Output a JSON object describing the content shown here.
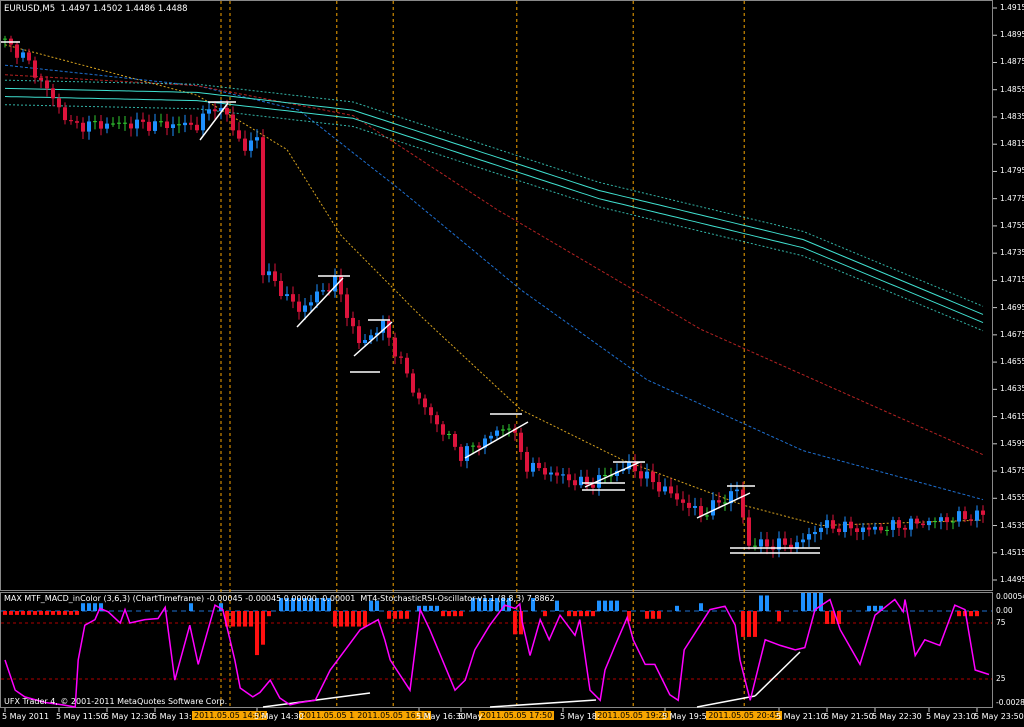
{
  "window": {
    "title": "EURUSD,M5  1.4497 1.4502 1.4486 1.4488"
  },
  "indicator": {
    "title": "MAX MTF_MACD_inColor (3,6,3) (ChartTimeframe) -0.00045 -0.00045 0.00000 -0.00001  MT4-StochasticRSI-Oscillator-v1.1 (8,8,3) 7.8862",
    "axis_labels": [
      "0.00054",
      "0.00",
      "75",
      "25",
      "-0.0028"
    ]
  },
  "copyright": "UFX Trader 4, © 2001-2011 MetaQuotes Software Corp.",
  "colors": {
    "bull": "#1E90FF",
    "bear": "#DC143C",
    "doji": "#32CD32",
    "vline": "#F7A500",
    "stoch": "#FF00FF",
    "teal": "#40E0D0",
    "ma_yellow": "#DAA520",
    "ma_blue": "#1E6FD0",
    "ma_red": "#B22222"
  },
  "chart_data": {
    "type": "candlestick",
    "symbol": "EURUSD",
    "timeframe": "M5",
    "ylim": [
      1.4495,
      1.4915
    ],
    "price_labels": [
      "1.4915",
      "1.4895",
      "1.4875",
      "1.4855",
      "1.4835",
      "1.4815",
      "1.4795",
      "1.4775",
      "1.4755",
      "1.4735",
      "1.4715",
      "1.4695",
      "1.4675",
      "1.4655",
      "1.4635",
      "1.4615",
      "1.4595",
      "1.4575",
      "1.4555",
      "1.4535",
      "1.4515",
      "1.4495"
    ],
    "time_labels": [
      [
        "5 May 2011",
        0
      ],
      [
        "5 May 11:50",
        9
      ],
      [
        "5 May 12:30",
        17
      ],
      [
        "5 May 13:",
        25
      ],
      [
        "5 May 14:30",
        42
      ],
      [
        "5 May 16:30",
        69
      ],
      [
        "5 May",
        76
      ],
      [
        "5 May 18:",
        93
      ],
      [
        "5 May 19:5",
        110
      ],
      [
        "5 May 21:10",
        129
      ],
      [
        "5 May 21:50",
        137
      ],
      [
        "5 May 22:30",
        145
      ],
      [
        "5 May 23:10",
        154
      ],
      [
        "5 May 23:50",
        162
      ]
    ],
    "vertical_lines": [
      [
        "",
        36
      ],
      [
        "2011.05.05 14:05",
        37.5
      ],
      [
        "2011.05.05 15:",
        55.3
      ],
      [
        "2011.05.05 16:10",
        64.7
      ],
      [
        "2011.05.05 17:50",
        85.3
      ],
      [
        "2011.05.05 19:20",
        104.7
      ],
      [
        "2011.05.05 20:45",
        123.2
      ]
    ],
    "bar_count": 164,
    "price_path": [
      [
        0,
        1.489
      ],
      [
        3,
        1.488
      ],
      [
        7,
        1.4855
      ],
      [
        11,
        1.4829
      ],
      [
        20,
        1.483
      ],
      [
        32,
        1.4829
      ],
      [
        35,
        1.4844
      ],
      [
        37,
        1.4835
      ],
      [
        40,
        1.4811
      ],
      [
        42,
        1.482
      ],
      [
        43,
        1.4723
      ],
      [
        49,
        1.4693
      ],
      [
        55,
        1.4715
      ],
      [
        59,
        1.4668
      ],
      [
        63,
        1.4682
      ],
      [
        69,
        1.4627
      ],
      [
        76,
        1.4587
      ],
      [
        84,
        1.4609
      ],
      [
        87,
        1.4579
      ],
      [
        97,
        1.4565
      ],
      [
        104,
        1.4579
      ],
      [
        116,
        1.4543
      ],
      [
        122,
        1.4561
      ],
      [
        124,
        1.4521
      ],
      [
        132,
        1.4521
      ],
      [
        136,
        1.4535
      ],
      [
        144,
        1.4532
      ],
      [
        163,
        1.4543
      ]
    ],
    "moving_averages": [
      {
        "name": "ma_yellow",
        "dash": "2,2",
        "points": [
          [
            0,
            1.4888
          ],
          [
            32,
            1.4851
          ],
          [
            47,
            1.4811
          ],
          [
            56,
            1.4748
          ],
          [
            69,
            1.469
          ],
          [
            86,
            1.462
          ],
          [
            103,
            1.4583
          ],
          [
            123,
            1.455
          ],
          [
            136,
            1.4535
          ],
          [
            163,
            1.4539
          ]
        ]
      },
      {
        "name": "ma_blue",
        "dash": "3,2",
        "points": [
          [
            0,
            1.4873
          ],
          [
            32,
            1.4858
          ],
          [
            49,
            1.484
          ],
          [
            66,
            1.4781
          ],
          [
            86,
            1.4708
          ],
          [
            107,
            1.4642
          ],
          [
            133,
            1.459
          ],
          [
            163,
            1.4554
          ]
        ]
      },
      {
        "name": "ma_red",
        "dash": "3,2",
        "points": [
          [
            0,
            1.4866
          ],
          [
            32,
            1.4858
          ],
          [
            58,
            1.4836
          ],
          [
            82,
            1.4767
          ],
          [
            116,
            1.4679
          ],
          [
            163,
            1.4587
          ]
        ]
      },
      {
        "name": "teal",
        "dash": "",
        "points": [
          [
            0,
            1.4856
          ],
          [
            32,
            1.4853
          ],
          [
            58,
            1.484
          ],
          [
            99,
            1.4781
          ],
          [
            133,
            1.4745
          ],
          [
            163,
            1.469
          ]
        ]
      }
    ],
    "macd": [
      [
        0,
        12,
        -0.00015
      ],
      [
        13,
        16,
        0.0003
      ],
      [
        31,
        31,
        0.0003
      ],
      [
        36,
        36,
        0.0003
      ],
      [
        37,
        41,
        -0.0006
      ],
      [
        42,
        42,
        -0.0017
      ],
      [
        43,
        43,
        -0.0013
      ],
      [
        44,
        44,
        -0.0002
      ],
      [
        46,
        54,
        0.0005
      ],
      [
        55,
        60,
        -0.0006
      ],
      [
        61,
        62,
        0.0004
      ],
      [
        64,
        67,
        -0.0003
      ],
      [
        69,
        72,
        0.0002
      ],
      [
        73,
        76,
        -0.0002
      ],
      [
        78,
        84,
        0.0005
      ],
      [
        85,
        86,
        -0.0009
      ],
      [
        88,
        88,
        0.0005
      ],
      [
        90,
        90,
        -0.0002
      ],
      [
        92,
        92,
        0.0004
      ],
      [
        94,
        98,
        -0.0002
      ],
      [
        99,
        102,
        0.0004
      ],
      [
        104,
        104,
        -0.0004
      ],
      [
        107,
        109,
        -0.0003
      ],
      [
        112,
        112,
        0.0002
      ],
      [
        116,
        116,
        0.0003
      ],
      [
        123,
        125,
        -0.001
      ],
      [
        126,
        127,
        0.0006
      ],
      [
        129,
        129,
        -0.0004
      ],
      [
        133,
        136,
        0.0007
      ],
      [
        137,
        139,
        -0.0005
      ],
      [
        144,
        146,
        0.0002
      ],
      [
        159,
        162,
        -0.0002
      ]
    ],
    "macd_ylim": [
      -0.0028,
      0.00054
    ],
    "stoch": [
      [
        0,
        42
      ],
      [
        1.7,
        15
      ],
      [
        3.3,
        9
      ],
      [
        6.7,
        4
      ],
      [
        9.5,
        2
      ],
      [
        11.7,
        0
      ],
      [
        12.2,
        42
      ],
      [
        13.3,
        73
      ],
      [
        15,
        78
      ],
      [
        15.8,
        88
      ],
      [
        17.2,
        85
      ],
      [
        19.2,
        75
      ],
      [
        20,
        87
      ],
      [
        20.8,
        75
      ],
      [
        23.3,
        78
      ],
      [
        25.5,
        79
      ],
      [
        26.7,
        89
      ],
      [
        28.3,
        24
      ],
      [
        30.8,
        73
      ],
      [
        32.2,
        38
      ],
      [
        35,
        91
      ],
      [
        36.3,
        87
      ],
      [
        38.3,
        42
      ],
      [
        39.2,
        17
      ],
      [
        41.3,
        9
      ],
      [
        42.5,
        13
      ],
      [
        44.2,
        24
      ],
      [
        45.8,
        8
      ],
      [
        47.5,
        2
      ],
      [
        49.2,
        4
      ],
      [
        51.7,
        6
      ],
      [
        54.2,
        33
      ],
      [
        56.7,
        51
      ],
      [
        59.2,
        69
      ],
      [
        62.2,
        78
      ],
      [
        63.3,
        60
      ],
      [
        64.2,
        42
      ],
      [
        67.5,
        15
      ],
      [
        69.2,
        87
      ],
      [
        70.8,
        69
      ],
      [
        75,
        15
      ],
      [
        76.7,
        24
      ],
      [
        78.3,
        51
      ],
      [
        80.8,
        73
      ],
      [
        83.3,
        91
      ],
      [
        85,
        88
      ],
      [
        85.8,
        92
      ],
      [
        86.2,
        76
      ],
      [
        87.5,
        46
      ],
      [
        89.2,
        78
      ],
      [
        90.7,
        60
      ],
      [
        92.5,
        82
      ],
      [
        95,
        64
      ],
      [
        95.8,
        78
      ],
      [
        97.5,
        15
      ],
      [
        99.2,
        6
      ],
      [
        100,
        33
      ],
      [
        101.7,
        55
      ],
      [
        103.7,
        80
      ],
      [
        104.7,
        60
      ],
      [
        106.7,
        38
      ],
      [
        108.3,
        38
      ],
      [
        110.8,
        11
      ],
      [
        112.2,
        6
      ],
      [
        113.2,
        51
      ],
      [
        117.5,
        87
      ],
      [
        120,
        90
      ],
      [
        121.7,
        73
      ],
      [
        122.5,
        42
      ],
      [
        124.2,
        6
      ],
      [
        126.7,
        60
      ],
      [
        129.2,
        55
      ],
      [
        131.7,
        51
      ],
      [
        133.3,
        53
      ],
      [
        135,
        87
      ],
      [
        137.5,
        96
      ],
      [
        139.2,
        69
      ],
      [
        142.5,
        38
      ],
      [
        145,
        82
      ],
      [
        148.3,
        96
      ],
      [
        149.7,
        85
      ],
      [
        150,
        96
      ],
      [
        151.7,
        46
      ],
      [
        153.3,
        60
      ],
      [
        155.8,
        55
      ],
      [
        158.3,
        91
      ],
      [
        160,
        87
      ],
      [
        161.7,
        33
      ],
      [
        164,
        29
      ]
    ],
    "stoch_levels": [
      75,
      25
    ]
  }
}
